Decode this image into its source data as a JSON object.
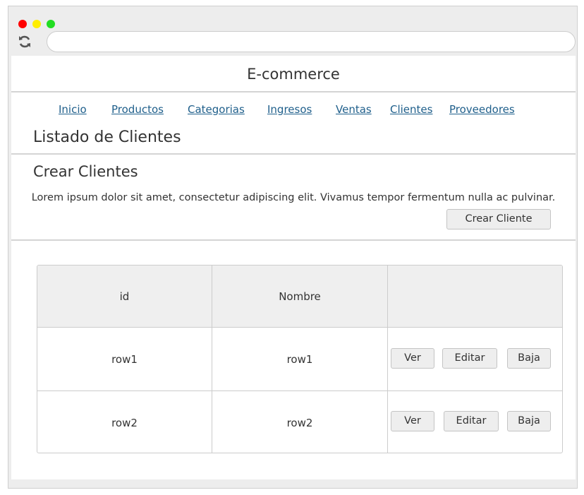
{
  "browser": {
    "address_value": "",
    "colors": {
      "close": "#ff0000",
      "minimize": "#ffee00",
      "maximize": "#22dd22"
    }
  },
  "site": {
    "title": "E-commerce"
  },
  "nav": {
    "items": [
      {
        "label": "Inicio"
      },
      {
        "label": "Productos"
      },
      {
        "label": "Categorias"
      },
      {
        "label": "Ingresos"
      },
      {
        "label": "Ventas"
      },
      {
        "label": "Clientes"
      },
      {
        "label": "Proveedores"
      }
    ]
  },
  "main": {
    "section_title": "Listado de Clientes",
    "create_title": "Crear Clientes",
    "description": "Lorem ipsum dolor sit amet, consectetur adipiscing elit. Vivamus tempor fermentum nulla ac pulvinar.",
    "create_button": "Crear Cliente"
  },
  "table": {
    "headers": [
      "id",
      "Nombre",
      ""
    ],
    "rows": [
      {
        "id": "row1",
        "nombre": "row1"
      },
      {
        "id": "row2",
        "nombre": "row2"
      }
    ],
    "actions": {
      "view": "Ver",
      "edit": "Editar",
      "delete": "Baja"
    }
  }
}
